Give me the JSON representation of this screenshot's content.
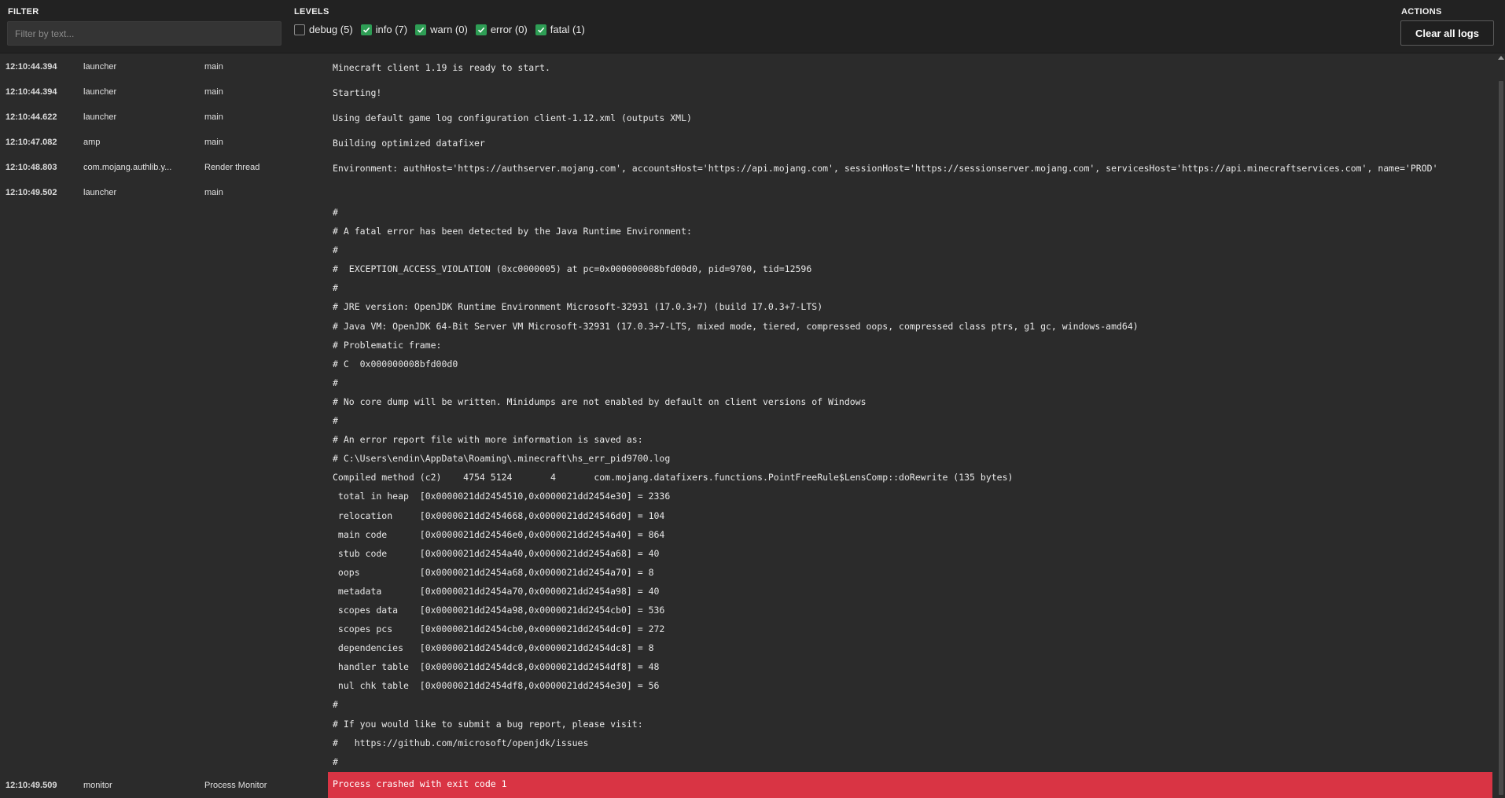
{
  "filter": {
    "label": "FILTER",
    "placeholder": "Filter by text...",
    "value": ""
  },
  "levels": {
    "label": "LEVELS",
    "items": [
      {
        "label": "debug (5)",
        "checked": false
      },
      {
        "label": "info (7)",
        "checked": true
      },
      {
        "label": "warn (0)",
        "checked": true
      },
      {
        "label": "error (0)",
        "checked": true
      },
      {
        "label": "fatal (1)",
        "checked": true
      }
    ]
  },
  "actions": {
    "label": "ACTIONS",
    "clear_label": "Clear all logs"
  },
  "logs": [
    {
      "time": "12:10:44.394",
      "source": "launcher",
      "thread": "main",
      "message": "Minecraft client 1.19 is ready to start."
    },
    {
      "time": "12:10:44.394",
      "source": "launcher",
      "thread": "main",
      "message": "Starting!"
    },
    {
      "time": "12:10:44.622",
      "source": "launcher",
      "thread": "main",
      "message": "Using default game log configuration client-1.12.xml (outputs XML)"
    },
    {
      "time": "12:10:47.082",
      "source": "amp",
      "thread": "main",
      "message": "Building optimized datafixer"
    },
    {
      "time": "12:10:48.803",
      "source": "com.mojang.authlib.y...",
      "thread": "Render thread",
      "message": "Environment: authHost='https://authserver.mojang.com', accountsHost='https://api.mojang.com', sessionHost='https://sessionserver.mojang.com', servicesHost='https://api.minecraftservices.com', name='PROD'"
    },
    {
      "time": "12:10:49.502",
      "source": "launcher",
      "thread": "main",
      "message": ""
    }
  ],
  "fatal_log": {
    "lines": [
      "#",
      "# A fatal error has been detected by the Java Runtime Environment:",
      "#",
      "#  EXCEPTION_ACCESS_VIOLATION (0xc0000005) at pc=0x000000008bfd00d0, pid=9700, tid=12596",
      "#",
      "# JRE version: OpenJDK Runtime Environment Microsoft-32931 (17.0.3+7) (build 17.0.3+7-LTS)",
      "# Java VM: OpenJDK 64-Bit Server VM Microsoft-32931 (17.0.3+7-LTS, mixed mode, tiered, compressed oops, compressed class ptrs, g1 gc, windows-amd64)",
      "# Problematic frame:",
      "# C  0x000000008bfd00d0",
      "#",
      "# No core dump will be written. Minidumps are not enabled by default on client versions of Windows",
      "#",
      "# An error report file with more information is saved as:",
      "# C:\\Users\\endin\\AppData\\Roaming\\.minecraft\\hs_err_pid9700.log",
      "Compiled method (c2)    4754 5124       4       com.mojang.datafixers.functions.PointFreeRule$LensComp::doRewrite (135 bytes)",
      " total in heap  [0x0000021dd2454510,0x0000021dd2454e30] = 2336",
      " relocation     [0x0000021dd2454668,0x0000021dd24546d0] = 104",
      " main code      [0x0000021dd24546e0,0x0000021dd2454a40] = 864",
      " stub code      [0x0000021dd2454a40,0x0000021dd2454a68] = 40",
      " oops           [0x0000021dd2454a68,0x0000021dd2454a70] = 8",
      " metadata       [0x0000021dd2454a70,0x0000021dd2454a98] = 40",
      " scopes data    [0x0000021dd2454a98,0x0000021dd2454cb0] = 536",
      " scopes pcs     [0x0000021dd2454cb0,0x0000021dd2454dc0] = 272",
      " dependencies   [0x0000021dd2454dc0,0x0000021dd2454dc8] = 8",
      " handler table  [0x0000021dd2454dc8,0x0000021dd2454df8] = 48",
      " nul chk table  [0x0000021dd2454df8,0x0000021dd2454e30] = 56",
      "#",
      "# If you would like to submit a bug report, please visit:",
      "#   https://github.com/microsoft/openjdk/issues",
      "#"
    ]
  },
  "crash_log": {
    "time": "12:10:49.509",
    "source": "monitor",
    "thread": "Process Monitor",
    "message": "Process crashed with exit code 1"
  },
  "colors": {
    "background": "#2b2b2b",
    "topbar": "#222222",
    "checkbox_on": "#2e9e55",
    "crash_bar": "#d93444"
  }
}
